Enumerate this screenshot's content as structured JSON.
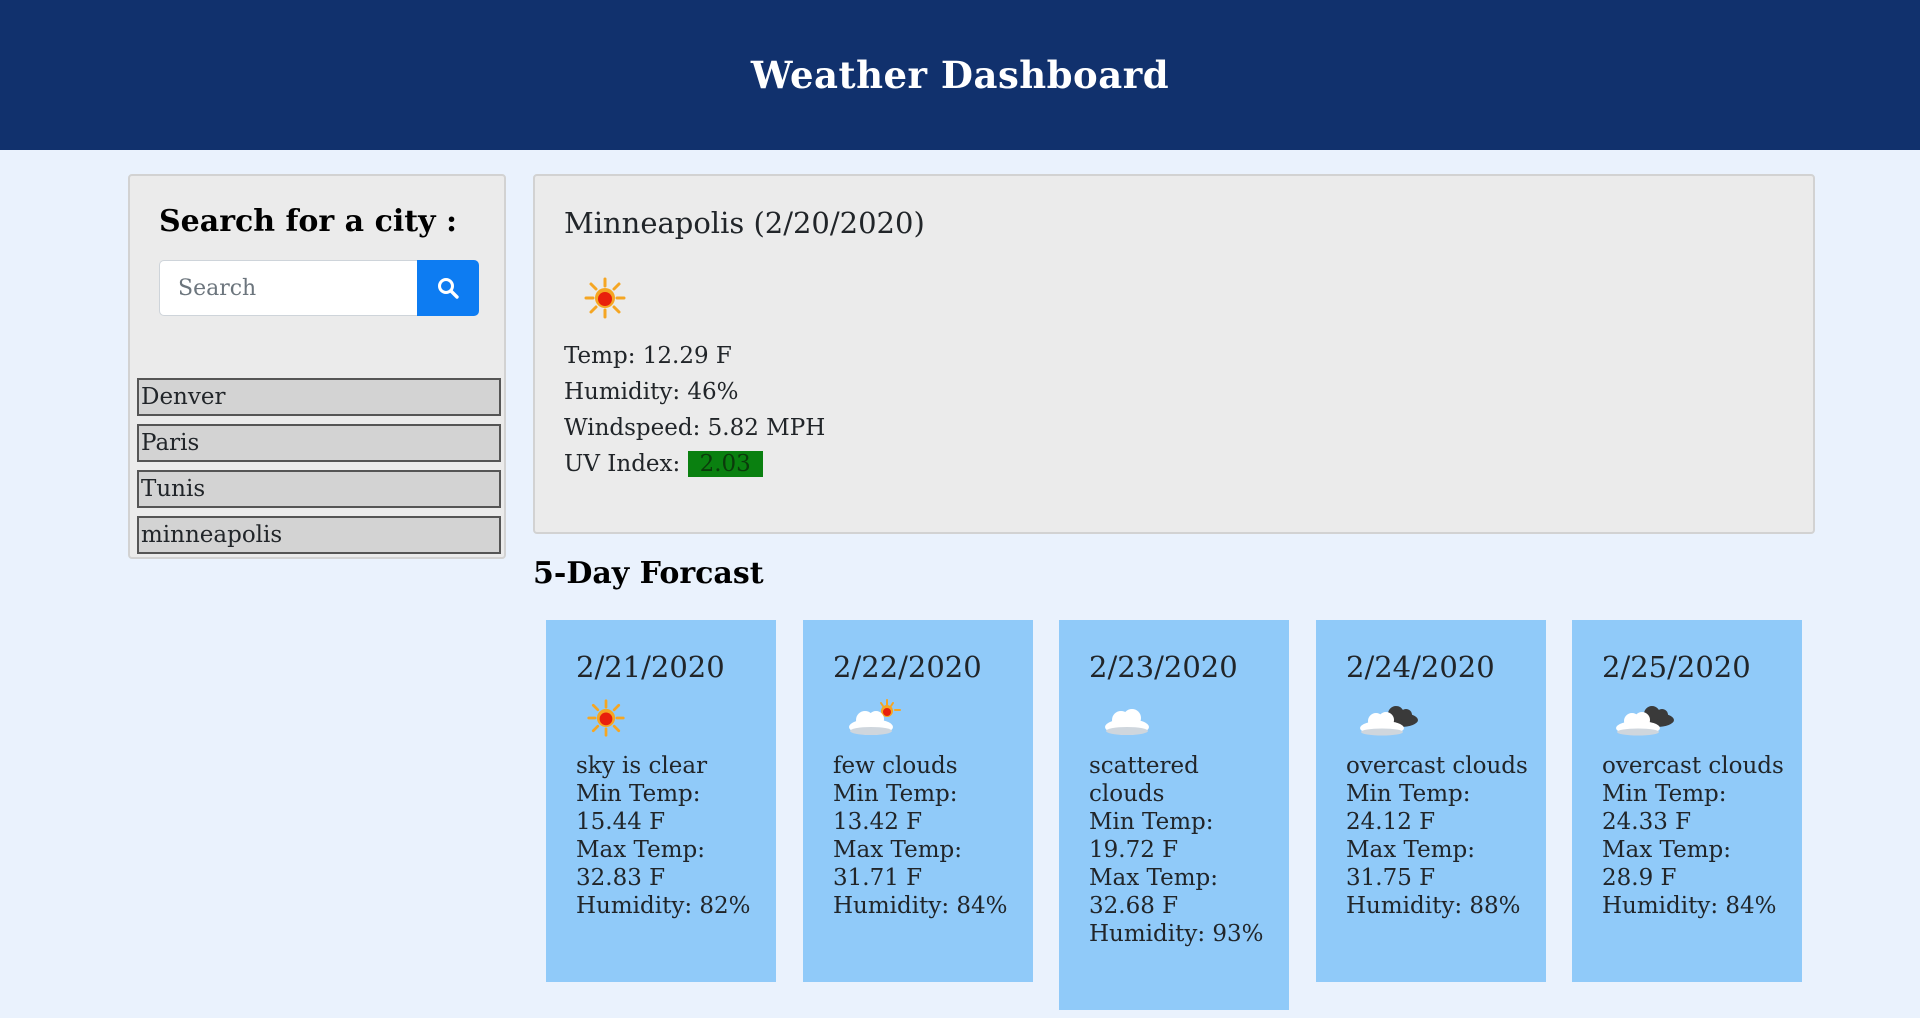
{
  "header": {
    "title": "Weather Dashboard"
  },
  "sidebar": {
    "heading": "Search for a city :",
    "search": {
      "placeholder": "Search",
      "value": ""
    },
    "search_button_icon": "search-icon",
    "cities": [
      "Denver",
      "Paris",
      "Tunis",
      "minneapolis"
    ]
  },
  "current": {
    "title": "Minneapolis (2/20/2020)",
    "icon": "sun-icon",
    "temp": "Temp: 12.29 F",
    "humidity": "Humidity: 46%",
    "windspeed": "Windspeed: 5.82 MPH",
    "uv_label": "UV Index:",
    "uv_value": "2.03",
    "uv_color": "#0a8010"
  },
  "forecast": {
    "title": "5-Day Forcast",
    "card_color": "#90caf9",
    "days": [
      {
        "date": "2/21/2020",
        "icon": "sun-icon",
        "desc": "sky is clear",
        "min_label": "Min Temp:",
        "min": "15.44 F",
        "max_label": "Max Temp:",
        "max": "32.83 F",
        "humidity": "Humidity: 82%"
      },
      {
        "date": "2/22/2020",
        "icon": "few-clouds-icon",
        "desc": "few clouds",
        "min_label": "Min Temp:",
        "min": "13.42 F",
        "max_label": "Max Temp:",
        "max": "31.71 F",
        "humidity": "Humidity: 84%"
      },
      {
        "date": "2/23/2020",
        "icon": "cloud-icon",
        "desc": "scattered clouds",
        "min_label": "Min Temp:",
        "min": "19.72 F",
        "max_label": "Max Temp:",
        "max": "32.68 F",
        "humidity": "Humidity: 93%"
      },
      {
        "date": "2/24/2020",
        "icon": "overcast-clouds-icon",
        "desc": "overcast clouds",
        "min_label": "Min Temp:",
        "min": "24.12 F",
        "max_label": "Max Temp:",
        "max": "31.75 F",
        "humidity": "Humidity: 88%"
      },
      {
        "date": "2/25/2020",
        "icon": "overcast-clouds-icon",
        "desc": "overcast clouds",
        "min_label": "Min Temp:",
        "min": "24.33 F",
        "max_label": "Max Temp:",
        "max": "28.9 F",
        "humidity": "Humidity: 84%"
      }
    ]
  }
}
